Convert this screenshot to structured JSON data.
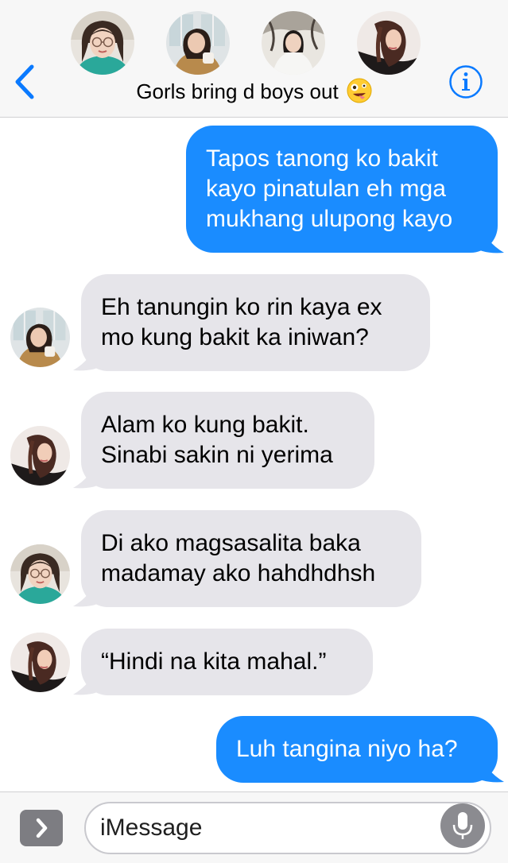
{
  "header": {
    "title": "Gorls bring d boys out",
    "title_emoji": "zany-face-emoji",
    "back_icon": "chevron-left-icon",
    "info_icon": "info-circle-icon",
    "participants": [
      {
        "avatar": "avatar-participant-1"
      },
      {
        "avatar": "avatar-participant-2"
      },
      {
        "avatar": "avatar-participant-3"
      },
      {
        "avatar": "avatar-participant-4"
      }
    ]
  },
  "messages": [
    {
      "direction": "outgoing",
      "lines": [
        "Tapos tanong ko bakit",
        "kayo pinatulan eh mga",
        "mukhang ulupong kayo"
      ]
    },
    {
      "direction": "incoming",
      "sender_avatar": "avatar-participant-2",
      "lines": [
        "Eh tanungin ko rin kaya ex",
        "mo kung bakit ka iniwan?"
      ]
    },
    {
      "direction": "incoming",
      "sender_avatar": "avatar-participant-4",
      "lines": [
        "Alam ko kung bakit.",
        "Sinabi sakin ni yerima"
      ]
    },
    {
      "direction": "incoming",
      "sender_avatar": "avatar-participant-1",
      "lines": [
        "Di ako magsasalita baka",
        "madamay ako hahdhdhsh"
      ]
    },
    {
      "direction": "incoming",
      "sender_avatar": "avatar-participant-4",
      "lines": [
        "“Hindi na kita mahal.”"
      ]
    },
    {
      "direction": "outgoing",
      "lines": [
        "Luh tangina niyo ha?"
      ]
    }
  ],
  "composer": {
    "placeholder": "iMessage",
    "value": "",
    "apps_icon": "chevron-right-icon",
    "mic_icon": "microphone-icon"
  },
  "colors": {
    "outgoing_bubble": "#1a8cff",
    "incoming_bubble": "#e6e5ea",
    "accent": "#0a7aff",
    "header_background": "#f7f7f7"
  }
}
